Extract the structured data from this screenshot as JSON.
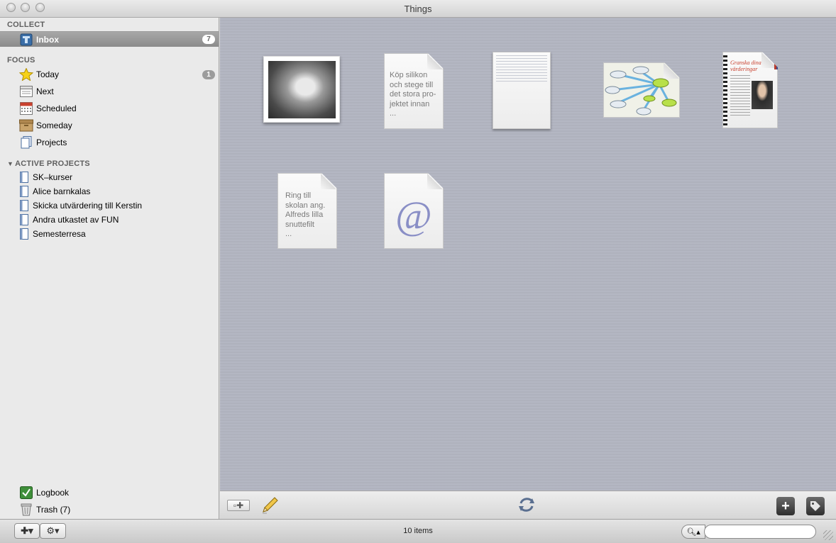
{
  "window": {
    "title": "Things"
  },
  "sidebar": {
    "collect_header": "COLLECT",
    "focus_header": "FOCUS",
    "active_projects_header": "ACTIVE PROJECTS",
    "collect_items": [
      {
        "label": "Inbox",
        "count": "7",
        "icon": "inbox-tray-icon",
        "selected": true
      }
    ],
    "focus_items": [
      {
        "label": "Today",
        "count": "1",
        "icon": "star-icon"
      },
      {
        "label": "Next",
        "icon": "next-list-icon"
      },
      {
        "label": "Scheduled",
        "icon": "calendar-icon"
      },
      {
        "label": "Someday",
        "icon": "box-icon"
      },
      {
        "label": "Projects",
        "icon": "projects-icon"
      }
    ],
    "projects": [
      {
        "label": "SK–kurser"
      },
      {
        "label": "Alice barnkalas"
      },
      {
        "label": "Skicka utvärdering till Kerstin"
      },
      {
        "label": "Andra utkastet av FUN"
      },
      {
        "label": "Semesterresa"
      }
    ],
    "bottom_items": [
      {
        "label": "Logbook",
        "icon": "logbook-check-icon"
      },
      {
        "label": "Trash (7)",
        "icon": "trash-icon"
      }
    ]
  },
  "inbox_items": [
    {
      "kind": "photo",
      "icon": "photo-thumbnail-icon"
    },
    {
      "kind": "note",
      "text_lines": [
        "Köp silikon",
        "och stege till",
        "det stora pro-",
        "jektet innan",
        "..."
      ]
    },
    {
      "kind": "document",
      "icon": "document-thumbnail-icon"
    },
    {
      "kind": "diagram",
      "icon": "mindmap-thumbnail-icon"
    },
    {
      "kind": "magazine",
      "icon": "magazine-thumbnail-icon"
    },
    {
      "kind": "note",
      "text_lines": [
        "Ring till",
        "skolan ang.",
        "Alfreds lilla",
        "snuttefilt",
        "..."
      ]
    },
    {
      "kind": "email",
      "icon": "at-sign-icon",
      "glyph": "@"
    }
  ],
  "status": {
    "item_count": "10 items"
  },
  "colors": {
    "main_bg": "#b2b5c1",
    "sidebar_bg": "#eaeaea",
    "selection": "#9a9a9a"
  }
}
